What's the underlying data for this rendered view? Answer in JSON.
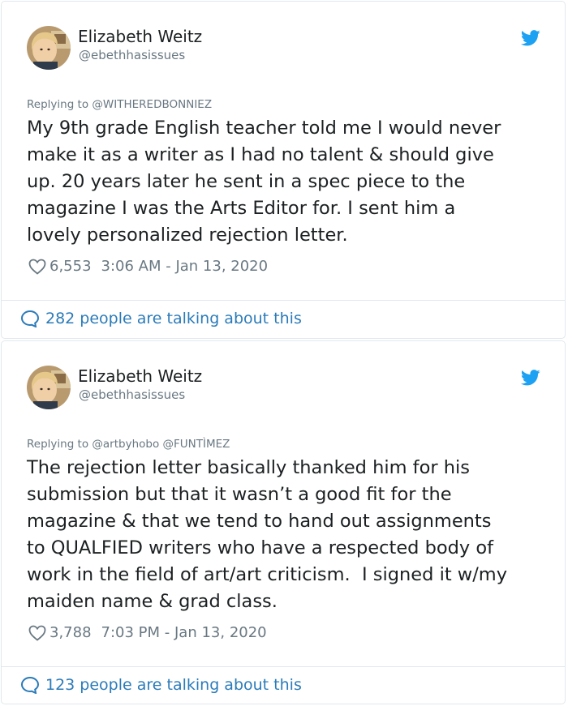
{
  "tweets": [
    {
      "author_name": "Elizabeth Weitz",
      "author_handle": "@ebethhasissues",
      "replying_label": "Replying to",
      "replying_to": "@WITHEREDBONNIEZ",
      "text": "My 9th grade English teacher told me I would never\nmake it as a writer as I had no talent & should give\nup. 20 years later he sent in a spec piece to the\nmagazine I was the Arts Editor for. I sent him a\nlovely personalized rejection letter.",
      "likes": "6,553",
      "timestamp": "3:06 AM - Jan 13, 2020",
      "talking": "282 people are talking about this"
    },
    {
      "author_name": "Elizabeth Weitz",
      "author_handle": "@ebethhasissues",
      "replying_label": "Replying to",
      "replying_to": "@artbyhobo @FUNTÌMEZ",
      "text": "The rejection letter basically thanked him for his\nsubmission but that it wasn’t a good fit for the\nmagazine & that we tend to hand out assignments\nto QUALFIED writers who have a respected body of\nwork in the field of art/art criticism.  I signed it w/my\nmaiden name & grad class.",
      "likes": "3,788",
      "timestamp": "7:03 PM - Jan 13, 2020",
      "talking": "123 people are talking about this"
    }
  ],
  "icons": {
    "twitter_bird": "twitter-bird-icon",
    "heart": "heart-icon",
    "comment": "comment-bubble-icon"
  },
  "colors": {
    "brand_blue": "#1da1f2",
    "link_blue": "#2b7bb9",
    "muted_text": "#697882",
    "primary_text": "#1c2022",
    "border": "#e1e8ed"
  }
}
